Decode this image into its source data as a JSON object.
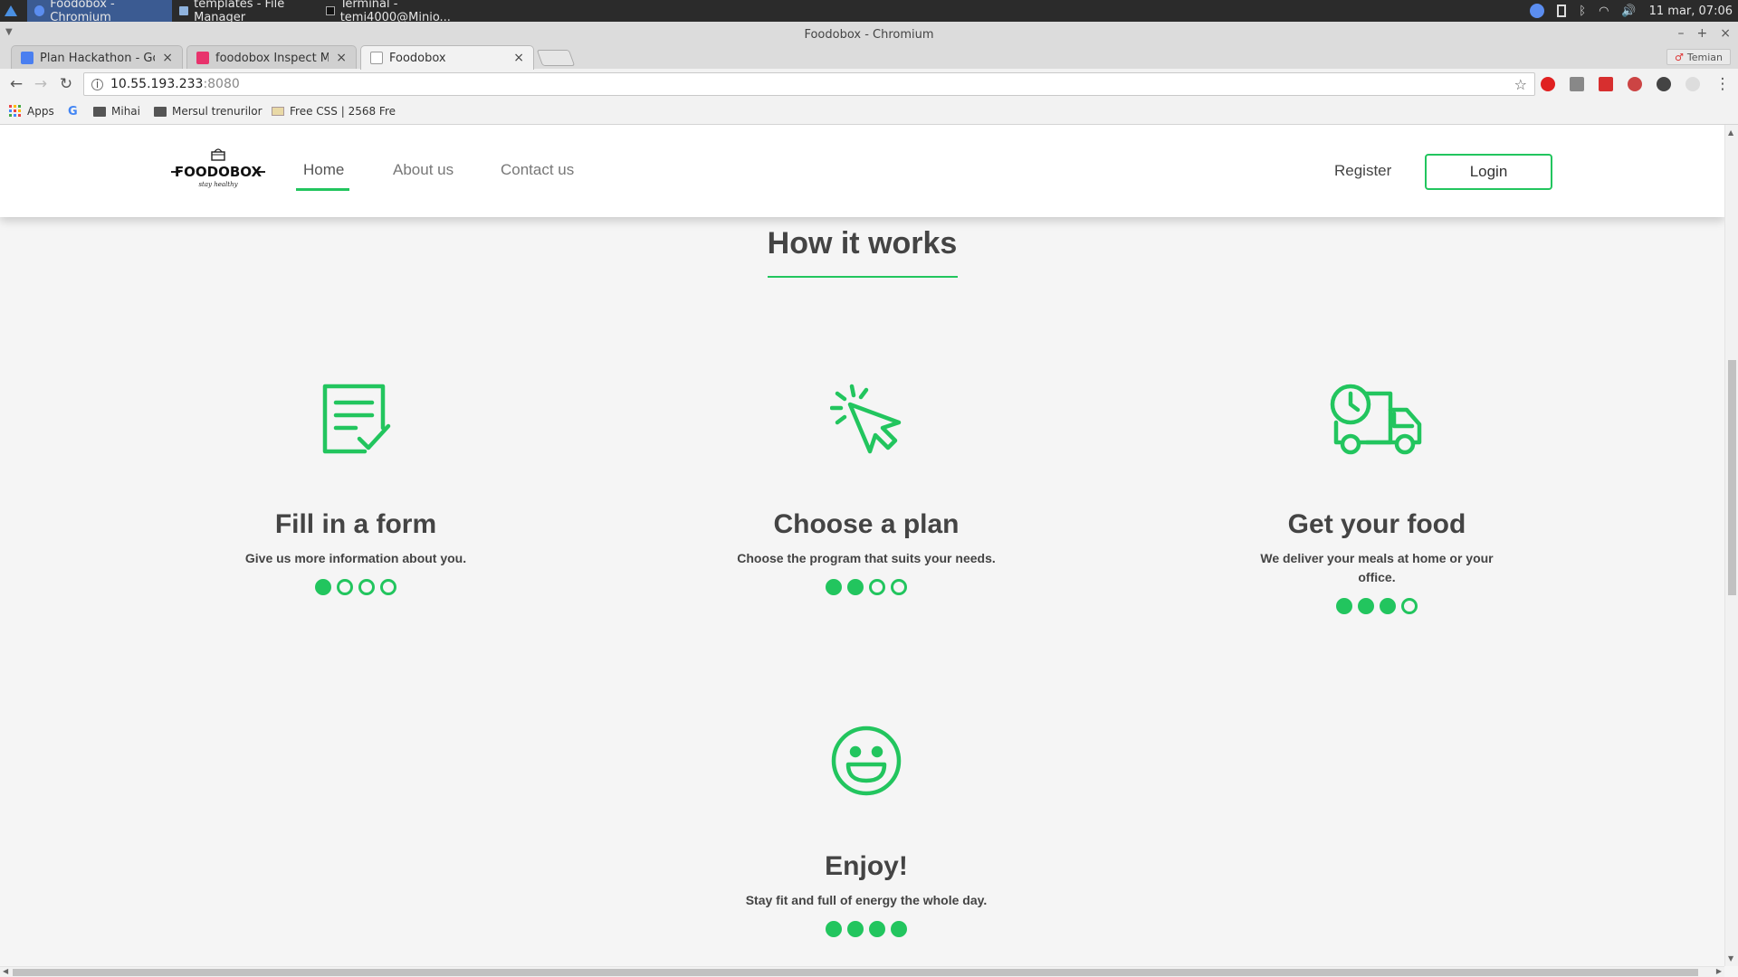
{
  "taskbar": {
    "tasks": [
      {
        "label": "Foodobox - Chromium",
        "icon": "chromium-icon",
        "active": true
      },
      {
        "label": "templates - File Manager",
        "icon": "folder-icon",
        "active": false
      },
      {
        "label": "Terminal - temi4000@Minio...",
        "icon": "terminal-icon",
        "active": false
      }
    ],
    "clock": "11 mar, 07:06"
  },
  "window": {
    "title": "Foodobox - Chromium",
    "minimize": "–",
    "maximize": "+",
    "close": "×"
  },
  "tabs": [
    {
      "label": "Plan Hackathon - Googl",
      "favicon": "google-docs-icon",
      "color": "#4a7ff0",
      "active": false
    },
    {
      "label": "foodobox Inspect Mode",
      "favicon": "invision-icon",
      "color": "#e8336c",
      "active": false
    },
    {
      "label": "Foodobox",
      "favicon": "page-icon",
      "color": "#ffffff",
      "active": true
    }
  ],
  "profile": {
    "label": "Temian"
  },
  "omnibox": {
    "host": "10.55.193.233",
    "port": ":8080"
  },
  "bookmarks": [
    {
      "label": "Apps",
      "icon": "apps-grid-icon"
    },
    {
      "label": "",
      "icon": "google-icon"
    },
    {
      "label": "Mihai",
      "icon": "folder-icon"
    },
    {
      "label": "Mersul trenurilor",
      "icon": "folder-icon"
    },
    {
      "label": "Free CSS | 2568 Fre",
      "icon": "page-icon"
    }
  ],
  "site": {
    "logo": {
      "word": "FOODOBOX",
      "tagline": "stay healthy"
    },
    "nav": [
      {
        "label": "Home",
        "active": true
      },
      {
        "label": "About us",
        "active": false
      },
      {
        "label": "Contact us",
        "active": false
      }
    ],
    "register": "Register",
    "login": "Login",
    "accent": "#22c55e"
  },
  "how_it_works": {
    "title": "How it works",
    "steps": [
      {
        "title": "Fill in a form",
        "description": "Give us more information about you.",
        "icon": "form-check-icon",
        "progress_filled": 1,
        "progress_total": 4
      },
      {
        "title": "Choose a plan",
        "description": "Choose the program that suits your needs.",
        "icon": "cursor-click-icon",
        "progress_filled": 2,
        "progress_total": 4
      },
      {
        "title": "Get your food",
        "description": "We deliver your meals at home or your office.",
        "icon": "delivery-truck-icon",
        "progress_filled": 3,
        "progress_total": 4
      },
      {
        "title": "Enjoy!",
        "description": "Stay fit and full of energy the whole day.",
        "icon": "smiley-icon",
        "progress_filled": 4,
        "progress_total": 4
      }
    ]
  }
}
